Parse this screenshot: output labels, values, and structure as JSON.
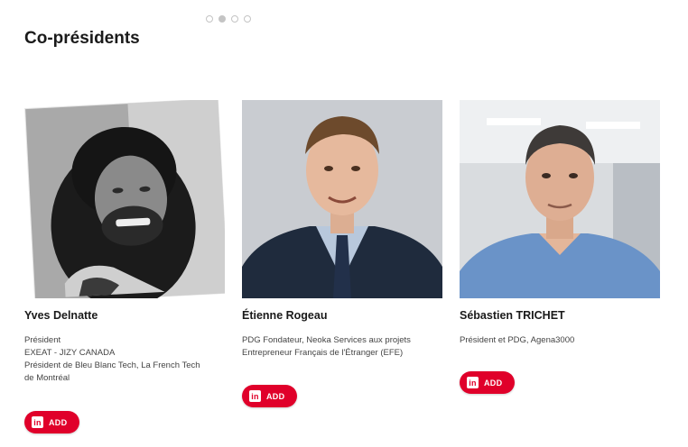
{
  "section": {
    "title": "Co-présidents"
  },
  "carousel": {
    "dot_count": 4,
    "active_index": 1
  },
  "members": [
    {
      "name": "Yves Delnatte",
      "lines": [
        "Président",
        "EXEAT - JIZY CANADA",
        "Président de Bleu Blanc Tech, La French Tech",
        "de Montréal"
      ],
      "button": {
        "icon": "in",
        "label": "ADD"
      }
    },
    {
      "name": "Étienne Rogeau",
      "lines": [
        "PDG Fondateur, Neoka Services aux projets",
        "Entrepreneur Français de l'Étranger (EFE)"
      ],
      "button": {
        "icon": "in",
        "label": "ADD"
      }
    },
    {
      "name": "Sébastien TRICHET",
      "lines": [
        "Président et PDG, Agena3000"
      ],
      "button": {
        "icon": "in",
        "label": "ADD"
      }
    }
  ],
  "colors": {
    "accent": "#e0002a",
    "text": "#1a1a1a"
  },
  "icons": {
    "linkedin": "linkedin-icon"
  }
}
